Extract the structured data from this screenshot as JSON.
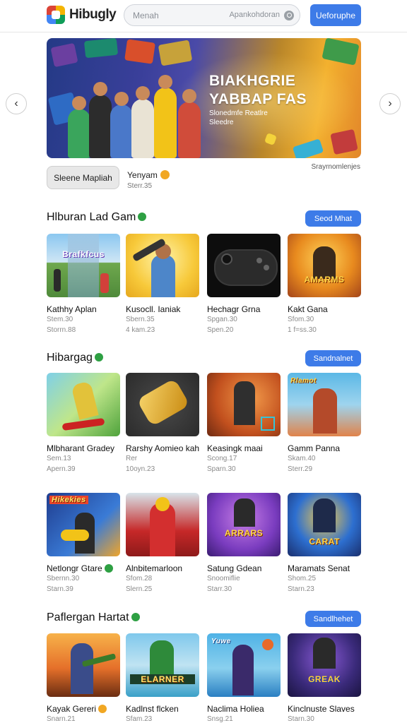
{
  "header": {
    "app_name": "Hibugly",
    "search_placeholder": "Menah",
    "search_hint": "Apankohdoran",
    "action_label": "Ueforuphe"
  },
  "banner": {
    "title_line1": "BIAKHGRIE",
    "title_line2": "YABBAP FAS",
    "sub_line1": "Slonedmfe Reatlre",
    "sub_line2": "Sleedre",
    "chip_label": "Sleene Mapliah",
    "featured_title": "Yenyam",
    "featured_meta": "Sterr.35",
    "caption": "Srayrnomlenjes"
  },
  "sections": [
    {
      "title": "Hlburan Lad Gam",
      "button": "Seod Mhat",
      "cards": [
        {
          "name": "Kathhy Aplan",
          "meta1": "Stem.30",
          "meta2": "Storrn.88",
          "art": "Brafkfcus"
        },
        {
          "name": "Kusocll. Ianiak",
          "meta1": "Sbern.35",
          "meta2": "4 kam.23",
          "art": ""
        },
        {
          "name": "Hechagr Grna",
          "meta1": "Spgan.30",
          "meta2": "Spen.20",
          "art": ""
        },
        {
          "name": "Kakt Gana",
          "meta1": "Sfom.30",
          "meta2": "1 f=ss.30",
          "art": "AMARMS"
        }
      ]
    },
    {
      "title": "Hibargag",
      "button": "Sandnalnet",
      "cards": [
        {
          "name": "Mlbharant Gradey",
          "meta1": "Sem.13",
          "meta2": "Apern.39",
          "art": ""
        },
        {
          "name": "Rarshy Aomieo kah",
          "meta1": "Rer",
          "meta2": "10oyn.23",
          "art": ""
        },
        {
          "name": "Keasingk maai",
          "meta1": "Scong.17",
          "meta2": "Sparn.30",
          "art": ""
        },
        {
          "name": "Gamm Panna",
          "meta1": "Skam.40",
          "meta2": "Sterr.29",
          "art": "Rlamot"
        }
      ]
    },
    {
      "title": "",
      "button": "",
      "cards": [
        {
          "name": "Netlongr Gtare",
          "meta1": "Sbernn.30",
          "meta2": "Starn.39",
          "art": "Hikekies"
        },
        {
          "name": "Alnbitemarloon",
          "meta1": "Sfom.28",
          "meta2": "Slern.25",
          "art": ""
        },
        {
          "name": "Satung Gdean",
          "meta1": "Snoomiflie",
          "meta2": "Starr.30",
          "art": "ARRARS"
        },
        {
          "name": "Maramats Senat",
          "meta1": "Shom.25",
          "meta2": "Starn.23",
          "art": "CARAT"
        }
      ]
    },
    {
      "title": "Paflergan Hartat",
      "button": "Sandlhehet",
      "cards": [
        {
          "name": "Kayak Gereri",
          "meta1": "Snarn.21",
          "meta2": "",
          "art": ""
        },
        {
          "name": "Kadlnst flcken",
          "meta1": "Sfam.23",
          "meta2": "",
          "art": "ELARNER"
        },
        {
          "name": "Naclima Holiea",
          "meta1": "Snsg.21",
          "meta2": "",
          "art": "Yuwe"
        },
        {
          "name": "Kinclnuste Slaves",
          "meta1": "Starn.30",
          "meta2": "",
          "art": "GREAK"
        }
      ]
    }
  ],
  "colors": {
    "accent": "#3d7be8",
    "verified": "#2ea043",
    "badge_orange": "#f1a723"
  }
}
